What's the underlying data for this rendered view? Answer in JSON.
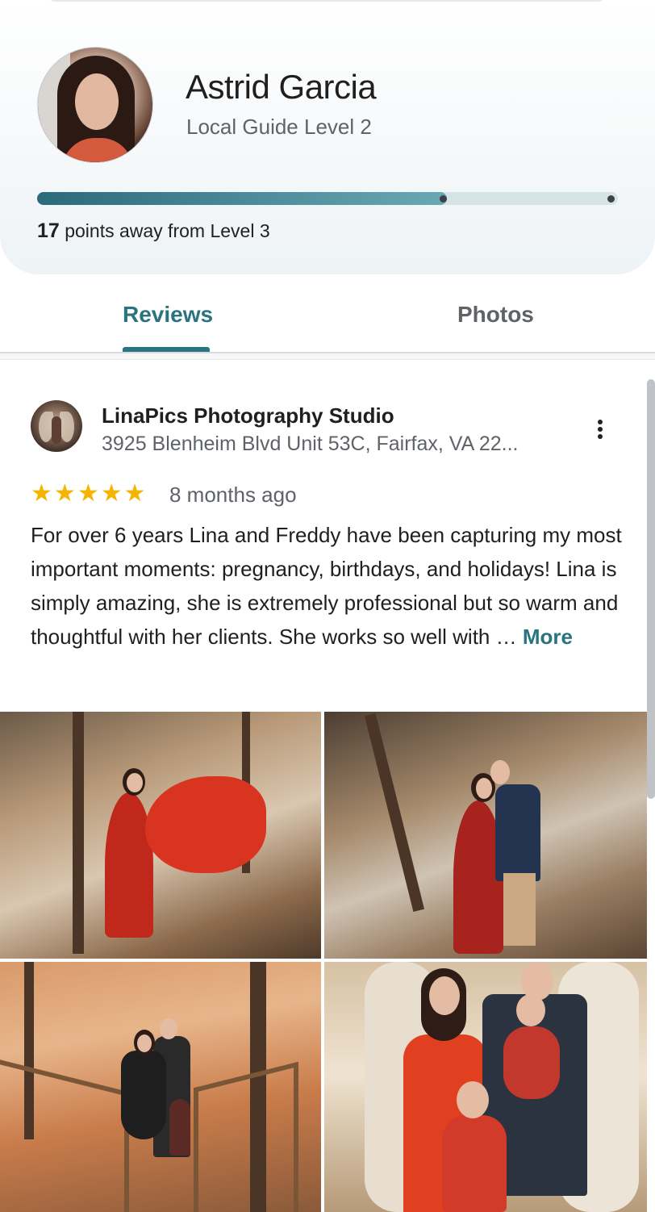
{
  "profile": {
    "name": "Astrid Garcia",
    "level_label": "Local Guide Level 2",
    "progress_fraction": 0.705,
    "points_number": "17",
    "points_suffix": "points away from Level 3"
  },
  "tabs": [
    {
      "label": "Reviews",
      "selected": true
    },
    {
      "label": "Photos",
      "selected": false
    }
  ],
  "review": {
    "place_name": "LinaPics Photography Studio",
    "place_address": "3925 Blenheim Blvd Unit 53C, Fairfax, VA 22...",
    "rating": 5,
    "stars": [
      "★",
      "★",
      "★",
      "★",
      "★"
    ],
    "date": "8 months ago",
    "text": "For over 6 years Lina and Freddy have been capturing my most important moments: pregnancy, birthdays, and holidays! Lina is simply amazing, she is extremely professional but so warm and thoughtful with her clients. She works so well with … ",
    "more_label": "More",
    "photo_count": 4
  },
  "colors": {
    "accent": "#2a7480",
    "star": "#f5b400",
    "text_secondary": "#5f6368"
  },
  "icons": {
    "more_menu": "more-vert-icon",
    "star": "star-icon"
  }
}
